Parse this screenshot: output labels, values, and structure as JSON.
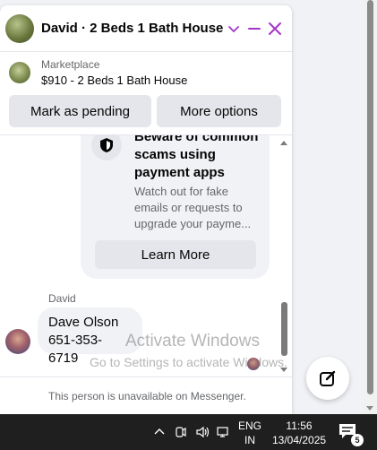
{
  "chat": {
    "title": "David · 2 Beds 1 Bath House",
    "listing_source": "Marketplace",
    "listing_name": "$910 - 2 Beds 1 Bath House",
    "actions": {
      "pending": "Mark as pending",
      "more": "More options"
    },
    "safety_card": {
      "title": "Beware of common scams using payment apps",
      "description": "Watch out for fake emails or requests to upgrade your payme...",
      "button": "Learn More"
    },
    "message": {
      "sender": "David",
      "line1": "Dave Olson",
      "line2": "651-353-6719"
    },
    "unavailable": "This person is unavailable on Messenger."
  },
  "watermark": {
    "line1": "Activate Windows",
    "line2": "Go to Settings to activate Windows."
  },
  "taskbar": {
    "lang_top": "ENG",
    "lang_bottom": "IN",
    "time": "11:56",
    "date": "13/04/2025",
    "notification_count": "5"
  },
  "colors": {
    "accent": "#a335c8",
    "button_bg": "#e4e6eb",
    "taskbar": "#1f1f1f"
  }
}
